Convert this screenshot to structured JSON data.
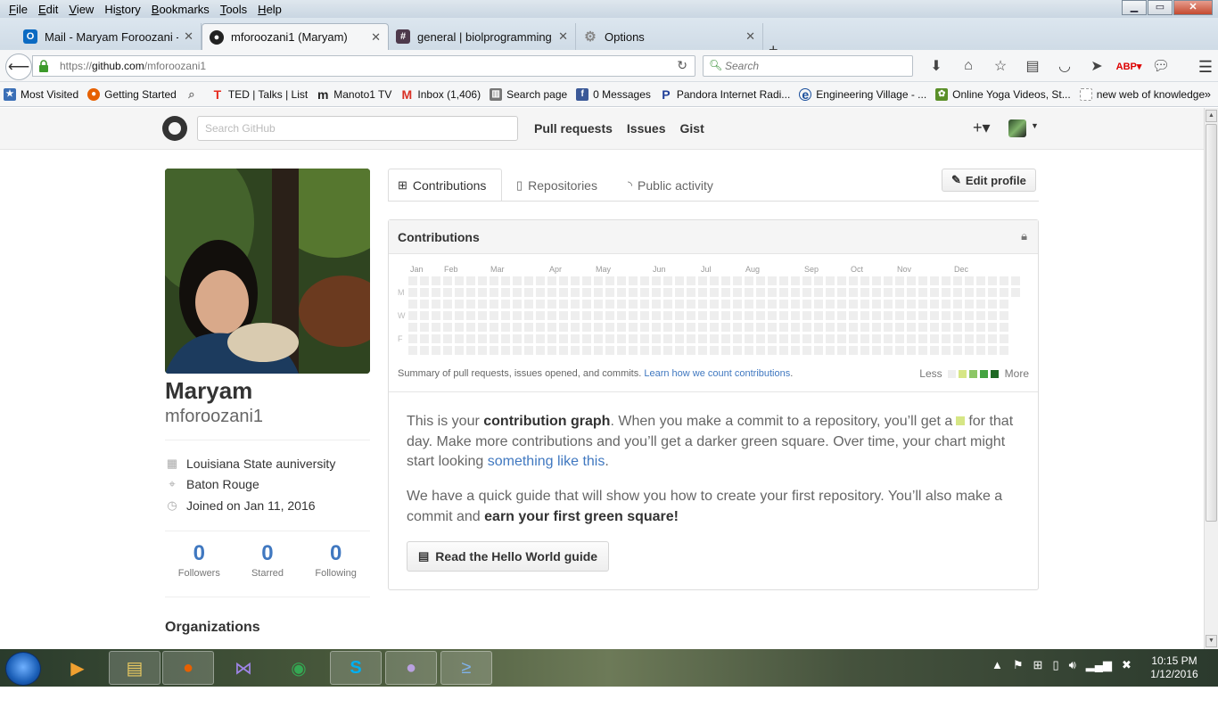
{
  "menubar": {
    "items": [
      {
        "pre": "",
        "ul": "F",
        "post": "ile"
      },
      {
        "pre": "",
        "ul": "E",
        "post": "dit"
      },
      {
        "pre": "",
        "ul": "V",
        "post": "iew"
      },
      {
        "pre": "Hi",
        "ul": "s",
        "post": "tory"
      },
      {
        "pre": "",
        "ul": "B",
        "post": "ookmarks"
      },
      {
        "pre": "",
        "ul": "T",
        "post": "ools"
      },
      {
        "pre": "",
        "ul": "H",
        "post": "elp"
      }
    ]
  },
  "tabs": [
    {
      "title": "Mail - Maryam Foroozani -...",
      "icon": "outlook-icon",
      "color": "#0b6ac2",
      "glyph": "O"
    },
    {
      "title": "mforoozani1 (Maryam)",
      "icon": "github-icon",
      "color": "#222",
      "glyph": "●"
    },
    {
      "title": "general | biolprogramming...",
      "icon": "slack-icon",
      "color": "#4d394b",
      "glyph": "#"
    },
    {
      "title": "Options",
      "icon": "gear-icon",
      "color": "#888",
      "glyph": "⚙"
    }
  ],
  "nav": {
    "url_scheme": "https://",
    "url_host": "github.com",
    "url_path": "/mforoozani1",
    "search_placeholder": "Search"
  },
  "bookmarks": [
    {
      "label": "Most Visited",
      "icon": "most-visited-icon",
      "color": "#3b6fb6",
      "glyph": "★"
    },
    {
      "label": "Getting Started",
      "icon": "firefox-icon",
      "color": "#e66000",
      "glyph": "●"
    },
    {
      "label": "",
      "icon": "search-icon",
      "color": "#888",
      "glyph": "⌕"
    },
    {
      "label": "TED | Talks | List",
      "icon": "ted-icon",
      "color": "#e62b1e",
      "glyph": "T"
    },
    {
      "label": "Manoto1 TV",
      "icon": "manoto-icon",
      "color": "#222",
      "glyph": "m"
    },
    {
      "label": "Inbox (1,406)",
      "icon": "gmail-icon",
      "color": "#d93025",
      "glyph": "M"
    },
    {
      "label": "Search page",
      "icon": "library-icon",
      "color": "#777",
      "glyph": "▥"
    },
    {
      "label": "0 Messages",
      "icon": "facebook-icon",
      "color": "#3b5998",
      "glyph": "f"
    },
    {
      "label": "Pandora Internet Radi...",
      "icon": "pandora-icon",
      "color": "#224099",
      "glyph": "P"
    },
    {
      "label": "Engineering Village - ...",
      "icon": "ev-icon",
      "color": "#1b4f9c",
      "glyph": "e"
    },
    {
      "label": "Online Yoga Videos, St...",
      "icon": "yoga-icon",
      "color": "#5a8f29",
      "glyph": "✿"
    },
    {
      "label": "new web of knowledge",
      "icon": "page-icon",
      "color": "#bbb",
      "glyph": ""
    }
  ],
  "github": {
    "search_placeholder": "Search GitHub",
    "nav": [
      "Pull requests",
      "Issues",
      "Gist"
    ],
    "plus": "+▾"
  },
  "profile": {
    "name": "Maryam",
    "username": "mforoozani1",
    "org": "Louisiana State auniversity",
    "location": "Baton Rouge",
    "joined": "Joined on Jan 11, 2016",
    "followers": "0",
    "followers_label": "Followers",
    "starred": "0",
    "starred_label": "Starred",
    "following": "0",
    "following_label": "Following",
    "organizations": "Organizations"
  },
  "profile_tabs": {
    "contributions": "Contributions",
    "repositories": "Repositories",
    "public_activity": "Public activity",
    "edit_profile": "Edit profile"
  },
  "contributions": {
    "title": "Contributions",
    "months": [
      "Jan",
      "Feb",
      "Mar",
      "Apr",
      "May",
      "Jun",
      "Jul",
      "Aug",
      "Sep",
      "Oct",
      "Nov",
      "Dec"
    ],
    "weekdays": [
      "M",
      "W",
      "F"
    ],
    "summary": "Summary of pull requests, issues opened, and commits.",
    "learn_link": "Learn how we count contributions",
    "less": "Less",
    "more": "More",
    "legend_colors": [
      "#eeeeee",
      "#d6e685",
      "#8cc665",
      "#44a340",
      "#1e6823"
    ],
    "p1_a": "This is your ",
    "p1_b": "contribution graph",
    "p1_c": ". When you make a commit to a repository, you’ll get a",
    "p1_d": "for that day. Make more contributions and you’ll get a darker green square. Over time, your chart might start looking ",
    "p1_link": "something like this",
    "p2_a": "We have a quick guide that will show you how to create your first repository. You’ll also make a commit and ",
    "p2_b": "earn your first green square!",
    "hello_button": "Read the Hello World guide"
  },
  "taskbar": {
    "apps": [
      {
        "name": "media-center-icon",
        "glyph": "▶",
        "color": "#f0a030"
      },
      {
        "name": "explorer-icon",
        "glyph": "▤",
        "color": "#e8c860"
      },
      {
        "name": "firefox-icon",
        "glyph": "●",
        "color": "#e66000"
      },
      {
        "name": "visual-studio-icon",
        "glyph": "⋈",
        "color": "#7b5dd0"
      },
      {
        "name": "chrome-icon",
        "glyph": "◉",
        "color": "#34a853"
      },
      {
        "name": "skype-icon",
        "glyph": "S",
        "color": "#00aff0"
      },
      {
        "name": "github-desktop-icon",
        "glyph": "●",
        "color": "#6e5494"
      },
      {
        "name": "powershell-icon",
        "glyph": "≥",
        "color": "#2d6fb5"
      }
    ],
    "time": "10:15 PM",
    "date": "1/12/2016"
  }
}
